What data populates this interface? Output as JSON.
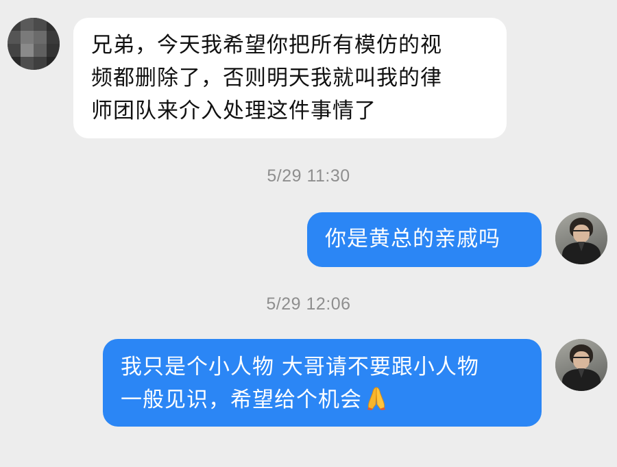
{
  "messages": [
    {
      "direction": "incoming",
      "lines": [
        "兄弟，今天我希望你把所有模仿的视",
        "频都删除了，否则明天我就叫我的律",
        "师团队来介入处理这件事情了"
      ]
    },
    {
      "direction": "outgoing",
      "timestamp": "5/29 11:30",
      "lines": [
        "你是黄总的亲戚吗"
      ]
    },
    {
      "direction": "outgoing",
      "timestamp": "5/29 12:06",
      "lines": [
        "我只是个小人物 大哥请不要跟小人物",
        "一般见识，希望给个机会"
      ],
      "trailing_emoji": "folded-hands-icon"
    }
  ],
  "colors": {
    "background": "#ededed",
    "incoming_bubble": "#ffffff",
    "outgoing_bubble": "#2b86f5",
    "timestamp_text": "#8e8e8e"
  }
}
